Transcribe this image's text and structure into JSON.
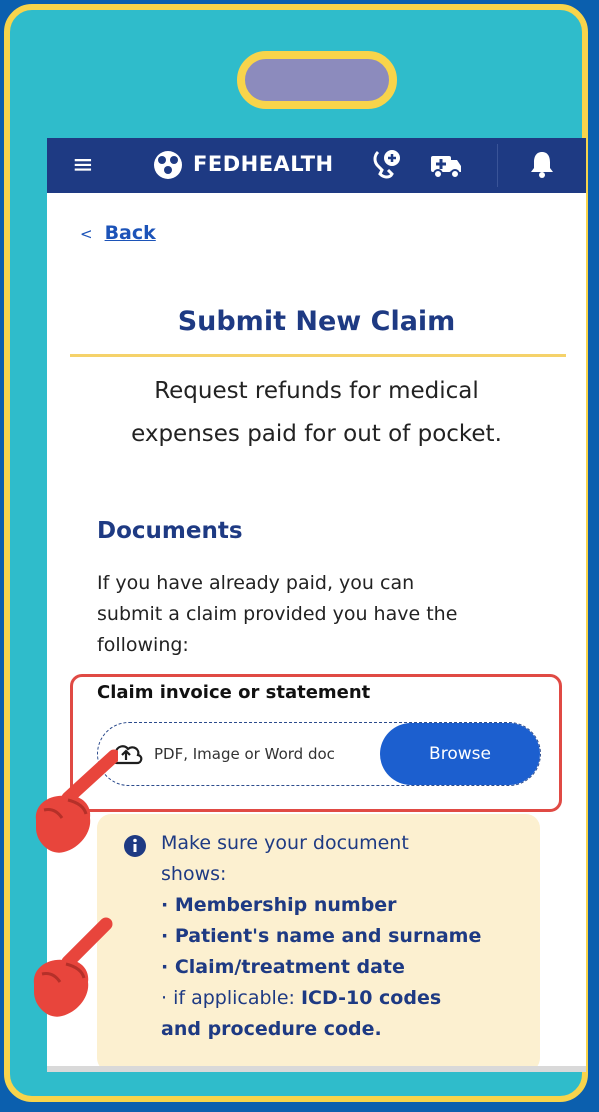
{
  "topbar": {
    "menu_icon": "hamburger-menu-icon",
    "brand": "FEDHEALTH",
    "icons": [
      "medical-assist-icon",
      "ambulance-icon",
      "bell-icon"
    ]
  },
  "nav": {
    "back_label": "Back"
  },
  "page": {
    "title": "Submit New Claim",
    "subtitle_line1": "Request refunds for medical",
    "subtitle_line2": "expenses paid for out of pocket."
  },
  "documents": {
    "heading": "Documents",
    "desc_line1": "If you have already paid, you can",
    "desc_line2": "submit a claim provided you have the",
    "desc_line3": "following:",
    "field_label": "Claim invoice or statement",
    "upload_placeholder": "PDF, Image or Word doc",
    "browse_label": "Browse"
  },
  "info": {
    "line1": "Make sure your document",
    "line2": "shows:",
    "item1": "· Membership number",
    "item2": "· Patient's name and surname",
    "item3": "· Claim/treatment date",
    "item4_prefix": "· if applicable: ",
    "item4_bold": "ICD-10 codes",
    "item5": "and procedure code."
  },
  "colors": {
    "brand_navy": "#1e3a83",
    "accent_blue": "#1c5fcf",
    "highlight_red": "#e04a44",
    "frame_yellow": "#f8d44b",
    "frame_teal": "#2fbccb",
    "info_bg": "#fcf0d0"
  }
}
